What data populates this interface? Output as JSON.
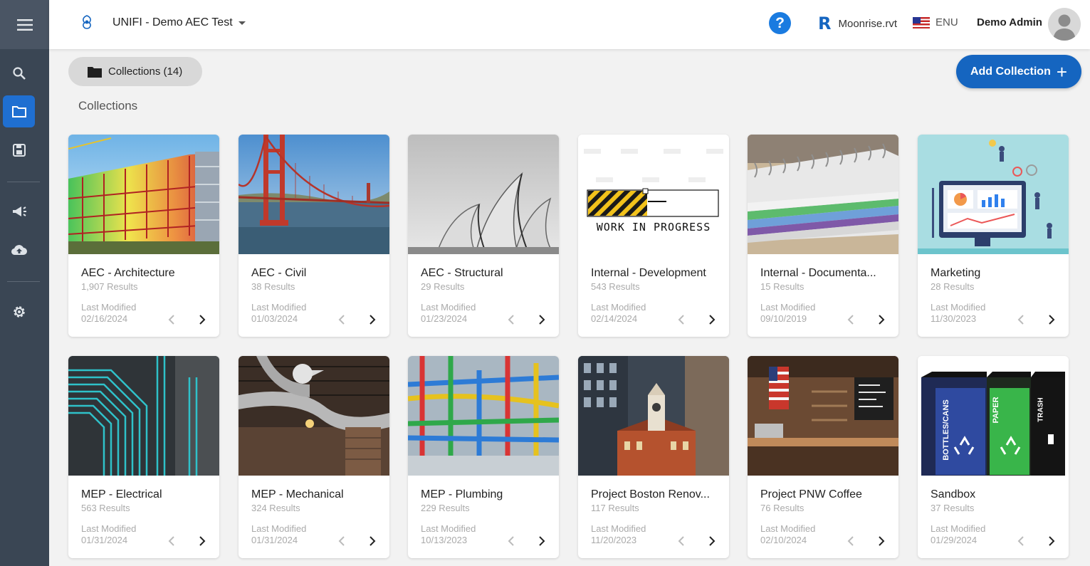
{
  "app": {
    "project_name": "UNIFI - Demo AEC Test",
    "help_symbol": "?",
    "revit_icon_letter": "R",
    "revit_file": "Moonrise.rvt",
    "language": "ENU",
    "user_name": "Demo Admin"
  },
  "sidebar": {
    "items": [
      {
        "icon": "menu-icon"
      },
      {
        "icon": "search-icon"
      },
      {
        "icon": "folder-icon",
        "active": true
      },
      {
        "icon": "save-icon"
      },
      {
        "icon": "megaphone-icon"
      },
      {
        "icon": "cloud-upload-icon"
      },
      {
        "icon": "gear-icon"
      }
    ]
  },
  "toolbar": {
    "collections_chip": "Collections (14)",
    "add_collection": "Add Collection",
    "add_symbol": "+"
  },
  "section_title": "Collections",
  "colors": {
    "accent": "#1565c0",
    "sidebar": "#3a4654",
    "active_nav": "#1f6fd1"
  },
  "cards": [
    {
      "title": "AEC - Architecture",
      "results": "1,907 Results",
      "last_modified_label": "Last Modified",
      "date": "02/16/2024"
    },
    {
      "title": "AEC - Civil",
      "results": "38 Results",
      "last_modified_label": "Last Modified",
      "date": "01/03/2024"
    },
    {
      "title": "AEC - Structural",
      "results": "29 Results",
      "last_modified_label": "Last Modified",
      "date": "01/23/2024"
    },
    {
      "title": "Internal - Development",
      "results": "543 Results",
      "last_modified_label": "Last Modified",
      "date": "02/14/2024",
      "wip_text": "WORK IN PROGRESS"
    },
    {
      "title": "Internal - Documenta...",
      "results": "15 Results",
      "last_modified_label": "Last Modified",
      "date": "09/10/2019"
    },
    {
      "title": "Marketing",
      "results": "28 Results",
      "last_modified_label": "Last Modified",
      "date": "11/30/2023"
    },
    {
      "title": "MEP - Electrical",
      "results": "563 Results",
      "last_modified_label": "Last Modified",
      "date": "01/31/2024"
    },
    {
      "title": "MEP - Mechanical",
      "results": "324 Results",
      "last_modified_label": "Last Modified",
      "date": "01/31/2024"
    },
    {
      "title": "MEP - Plumbing",
      "results": "229 Results",
      "last_modified_label": "Last Modified",
      "date": "10/13/2023"
    },
    {
      "title": "Project Boston Renov...",
      "results": "117 Results",
      "last_modified_label": "Last Modified",
      "date": "11/20/2023"
    },
    {
      "title": "Project PNW Coffee",
      "results": "76 Results",
      "last_modified_label": "Last Modified",
      "date": "02/10/2024"
    },
    {
      "title": "Sandbox",
      "results": "37 Results",
      "last_modified_label": "Last Modified",
      "date": "01/29/2024",
      "bin_labels": [
        "BOTTLES/CANS",
        "PAPER",
        "TRASH"
      ]
    }
  ]
}
